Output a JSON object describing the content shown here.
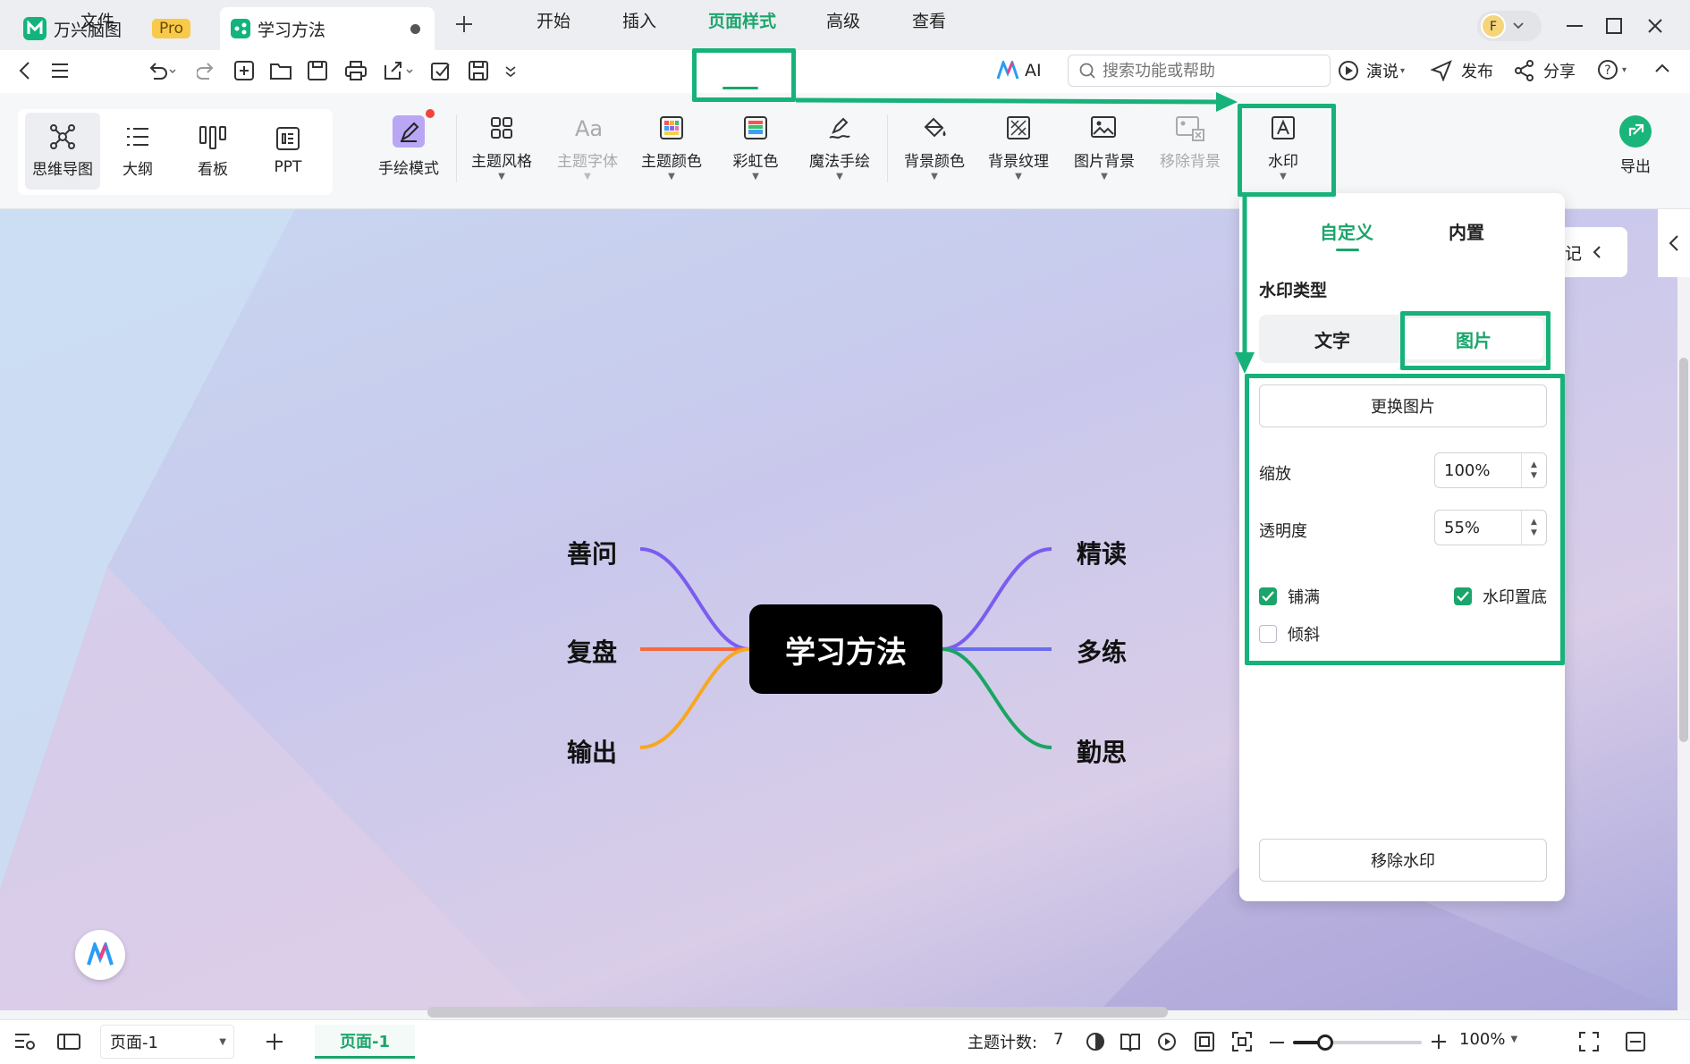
{
  "titlebar": {
    "app_name": "万兴脑图",
    "pro_badge": "Pro",
    "doc_tab_title": "学习方法"
  },
  "menu": {
    "file": "文件",
    "items": [
      "开始",
      "插入",
      "页面样式",
      "高级",
      "查看",
      "AI"
    ],
    "active": "页面样式",
    "search_placeholder": "搜索功能或帮助",
    "present": "演说",
    "publish": "发布",
    "share": "分享"
  },
  "ribbon": {
    "views": [
      "思维导图",
      "大纲",
      "看板",
      "PPT"
    ],
    "hand_drawn": "手绘模式",
    "theme_style": "主题风格",
    "theme_font": "主题字体",
    "theme_color": "主题颜色",
    "rainbow": "彩虹色",
    "magic_draw": "魔法手绘",
    "bg_color": "背景颜色",
    "bg_texture": "背景纹理",
    "image_bg": "图片背景",
    "remove_bg": "移除背景",
    "watermark": "水印",
    "export": "导出"
  },
  "mindmap": {
    "center": "学习方法",
    "left": [
      "善问",
      "复盘",
      "输出"
    ],
    "right": [
      "精读",
      "多练",
      "勤思"
    ],
    "branch_colors": {
      "善问": "#7b5cf0",
      "复盘": "#f56a3a",
      "输出": "#f7a722",
      "精读": "#7b5cf0",
      "多练": "#6a6cf0",
      "勤思": "#1aa562"
    }
  },
  "notes_tab": "记",
  "panel": {
    "tabs": [
      "自定义",
      "内置"
    ],
    "active_tab": "自定义",
    "type_label": "水印类型",
    "type_options": [
      "文字",
      "图片"
    ],
    "type_selected": "图片",
    "change_image": "更换图片",
    "scale_label": "缩放",
    "scale_value": "100%",
    "opacity_label": "透明度",
    "opacity_value": "55%",
    "tile_label": "铺满",
    "tile_checked": true,
    "bottom_label": "水印置底",
    "bottom_checked": true,
    "tilt_label": "倾斜",
    "tilt_checked": false,
    "remove_watermark": "移除水印"
  },
  "statusbar": {
    "page_select": "页面-1",
    "page_tab": "页面-1",
    "topic_count_label": "主题计数:",
    "topic_count": "7",
    "zoom": "100%",
    "zoom_level": 0.25
  },
  "colors": {
    "accent": "#1ba56b",
    "highlight": "#16b27a"
  }
}
